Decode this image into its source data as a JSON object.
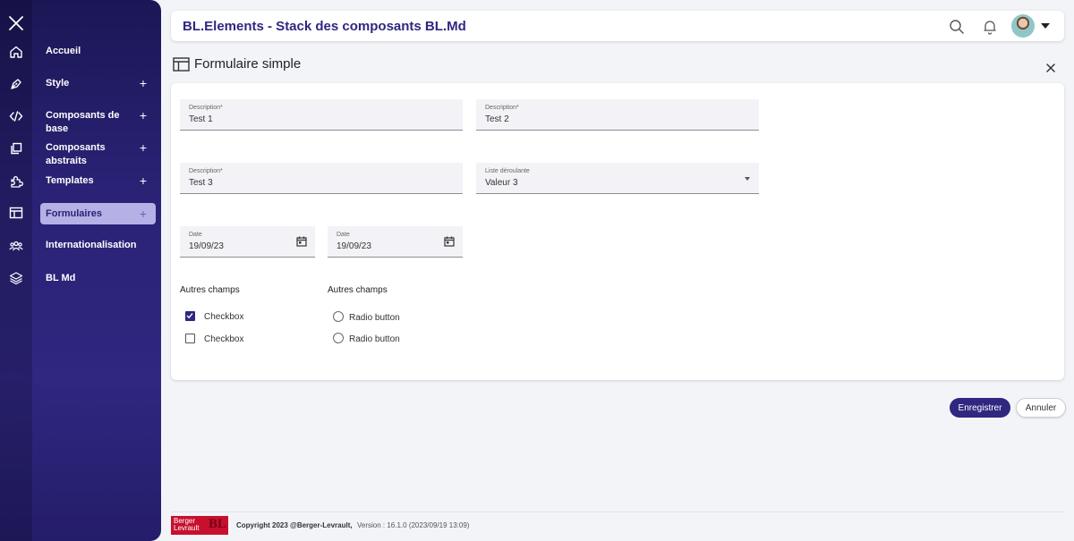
{
  "app": {
    "title": "BL.Elements - Stack des composants BL.Md"
  },
  "sidebar": {
    "items": [
      {
        "label": "Accueil",
        "icon": "home-icon",
        "expandable": false,
        "active": false
      },
      {
        "label": "Style",
        "icon": "pen-icon",
        "expandable": true,
        "active": false
      },
      {
        "label": "Composants de base",
        "icon": "code-icon",
        "expandable": true,
        "active": false
      },
      {
        "label": "Composants abstraits",
        "icon": "copy-icon",
        "expandable": true,
        "active": false
      },
      {
        "label": "Templates",
        "icon": "puzzle-icon",
        "expandable": true,
        "active": false
      },
      {
        "label": "Formulaires",
        "icon": "form-layout-icon",
        "expandable": true,
        "active": true
      },
      {
        "label": "Internationalisation",
        "icon": "people-icon",
        "expandable": false,
        "active": false
      },
      {
        "label": "BL Md",
        "icon": "layers-icon",
        "expandable": false,
        "active": false
      }
    ],
    "plus": "+"
  },
  "page": {
    "title": "Formulaire simple"
  },
  "form": {
    "field1": {
      "label": "Description*",
      "value": "Test 1"
    },
    "field2": {
      "label": "Description*",
      "value": "Test 2"
    },
    "field3": {
      "label": "Description*",
      "value": "Test 3"
    },
    "select1": {
      "label": "Liste déroulante",
      "value": "Valeur 3"
    },
    "date1": {
      "label": "Date",
      "value": "19/09/23"
    },
    "date2": {
      "label": "Date",
      "value": "19/09/23"
    },
    "checks": {
      "title": "Autres champs",
      "items": [
        {
          "label": "Checkbox",
          "checked": true
        },
        {
          "label": "Checkbox",
          "checked": false
        }
      ]
    },
    "radios": {
      "title": "Autres champs",
      "items": [
        {
          "label": "Radio button",
          "selected": false
        },
        {
          "label": "Radio button",
          "selected": false
        }
      ]
    }
  },
  "actions": {
    "save": "Enregistrer",
    "cancel": "Annuler"
  },
  "footer": {
    "logo_line1": "Berger",
    "logo_line2": "Levrault",
    "logo_mark": "BL",
    "copyright": "Copyright 2023 @Berger-Levrault,",
    "version": "Version : 16.1.0 (2023/09/19 13:09)"
  },
  "colors": {
    "primary": "#2f2780",
    "sidebar": "#2a2275",
    "active_item": "#b5b0e6",
    "logo": "#c8102e"
  }
}
